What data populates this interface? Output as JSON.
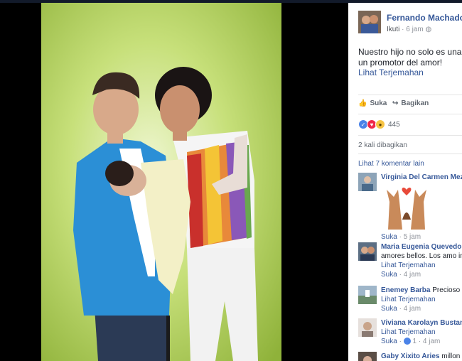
{
  "post": {
    "author": "Fernando Machado",
    "follow": "Ikuti",
    "time": "6 jam",
    "text_line1": "Nuestro hijo no solo es una b",
    "text_line2": "un promotor del amor!",
    "translate": "Lihat Terjemahan"
  },
  "actions": {
    "like": "Suka",
    "share": "Bagikan"
  },
  "reactions": {
    "count": "445"
  },
  "shares": "2 kali dibagikan",
  "more_comments": "Lihat 7 komentar lain",
  "comments": [
    {
      "name": "Virginia Del Carmen Meza",
      "text": "",
      "like": "Suka",
      "time": "5 jam"
    },
    {
      "name": "Maria Eugenia Quevedo E",
      "text": "amores bellos. Los amo in",
      "translate": "Lihat Terjemahan",
      "like": "Suka",
      "time": "4 jam"
    },
    {
      "name": "Enemey Barba",
      "text": "Precioso",
      "translate": "Lihat Terjemahan",
      "like": "Suka",
      "time": "4 jam"
    },
    {
      "name": "Viviana Karolayn Bustam",
      "text": "",
      "translate": "Lihat Terjemahan",
      "like": "Suka",
      "like_count": "1",
      "time": "4 jam"
    },
    {
      "name": "Gaby Xixito Aries",
      "text": "millon b"
    }
  ],
  "colors": {
    "link": "#365899",
    "meta": "#90949c",
    "photo_bg": "#b5d65a",
    "jacket": "#2b8fd6"
  }
}
